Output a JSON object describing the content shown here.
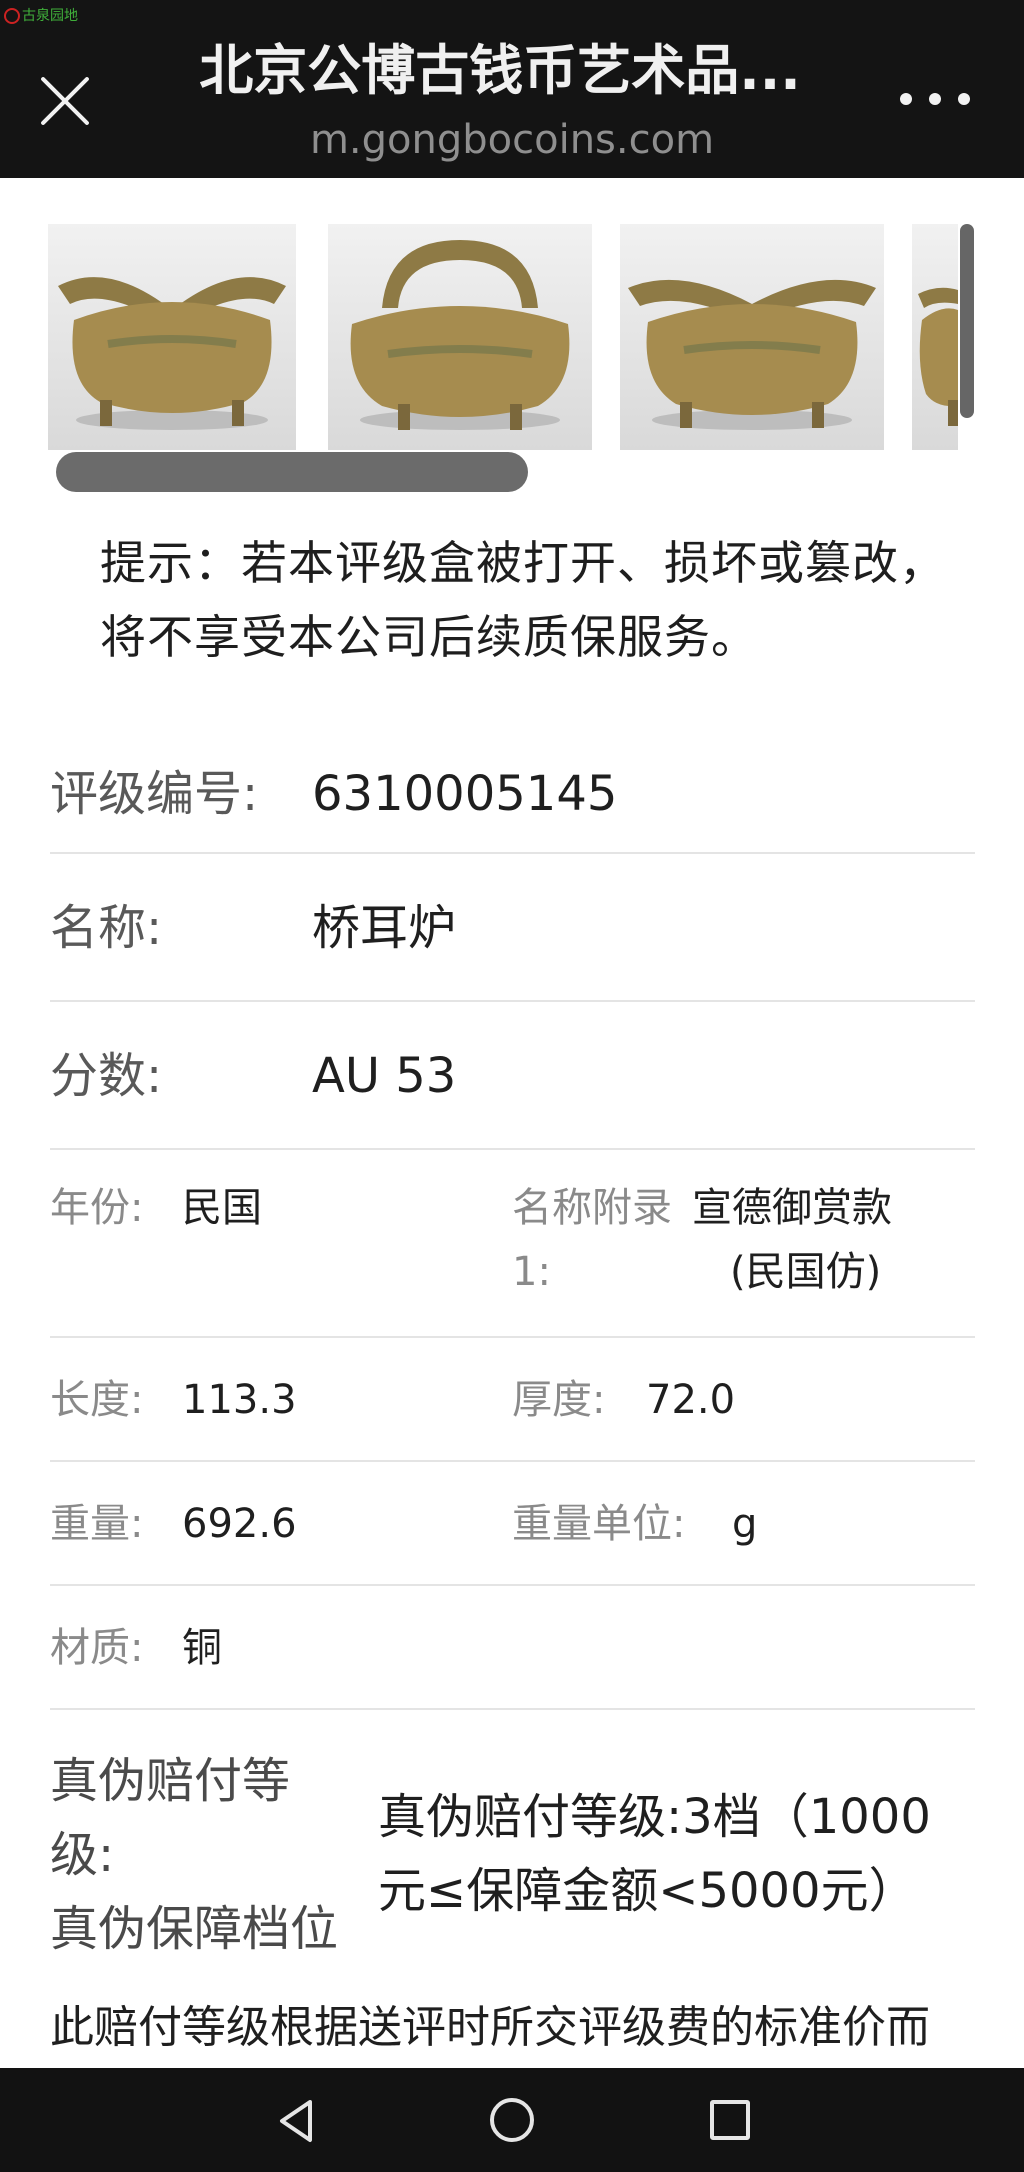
{
  "header": {
    "watermark": "古泉园地",
    "title": "北京公博古钱币艺术品...",
    "url": "m.gongbocoins.com"
  },
  "notice": "提示：若本评级盒被打开、损坏或篡改，将不享受本公司后续质保服务。",
  "fields": {
    "grade_no_label": "评级编号:",
    "grade_no_value": "6310005145",
    "name_label": "名称:",
    "name_value": "桥耳炉",
    "score_label": "分数:",
    "score_value": "AU 53",
    "year_label": "年份:",
    "year_value": "民国",
    "name_appendix_label_1": "名称附录",
    "name_appendix_label_2": "1:",
    "name_appendix_value_1": "宣德御赏款",
    "name_appendix_value_2": "(民国仿)",
    "length_label": "长度:",
    "length_value": "113.3",
    "thickness_label": "厚度:",
    "thickness_value": "72.0",
    "weight_label": "重量:",
    "weight_value": "692.6",
    "weight_unit_label": "重量单位:",
    "weight_unit_value": "g",
    "material_label": "材质:",
    "material_value": "铜"
  },
  "guarantee": {
    "label_line1": "真伪赔付等",
    "label_line2": "级:",
    "label_line3": "真伪保障档位",
    "value_line1": "真伪赔付等级:3档（1000",
    "value_line2": "元≤保障金额<5000元）"
  },
  "footnote": "此赔付等级根据送评时所交评级费的标准价而"
}
